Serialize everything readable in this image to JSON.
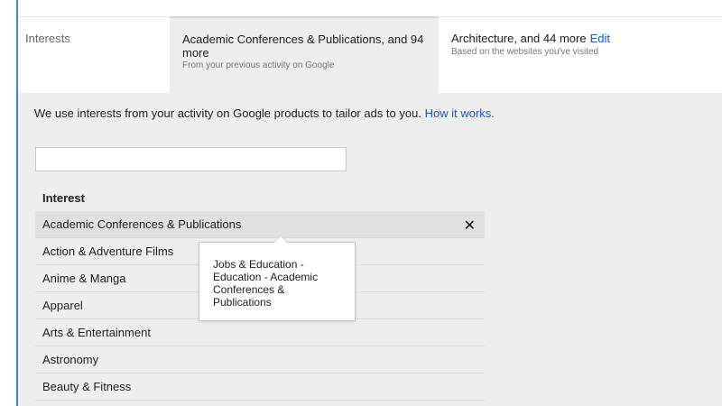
{
  "header": {
    "interests_label": "Interests",
    "active_title": "Academic Conferences & Publications, and 94 more",
    "active_sub": "From your previous activity on Google",
    "right_title": "Architecture, and 44 more",
    "right_edit": "Edit",
    "right_sub": "Based on the websites you've visited"
  },
  "intro": {
    "text": "We use interests from your activity on Google products to tailor ads to you.",
    "link": "How it works."
  },
  "search": {
    "value": "",
    "placeholder": ""
  },
  "list": {
    "header": "Interest",
    "items": [
      "Academic Conferences & Publications",
      "Action & Adventure Films",
      "Anime & Manga",
      "Apparel",
      "Arts & Entertainment",
      "Astronomy",
      "Beauty & Fitness"
    ],
    "close_glyph": "✕"
  },
  "tooltip": {
    "text": "Jobs & Education - Education - Academic Conferences & Publications"
  },
  "colors": {
    "accent_blue": "#1a55d0",
    "left_rule": "#4a7be0",
    "panel_bg": "#eeeeee"
  }
}
